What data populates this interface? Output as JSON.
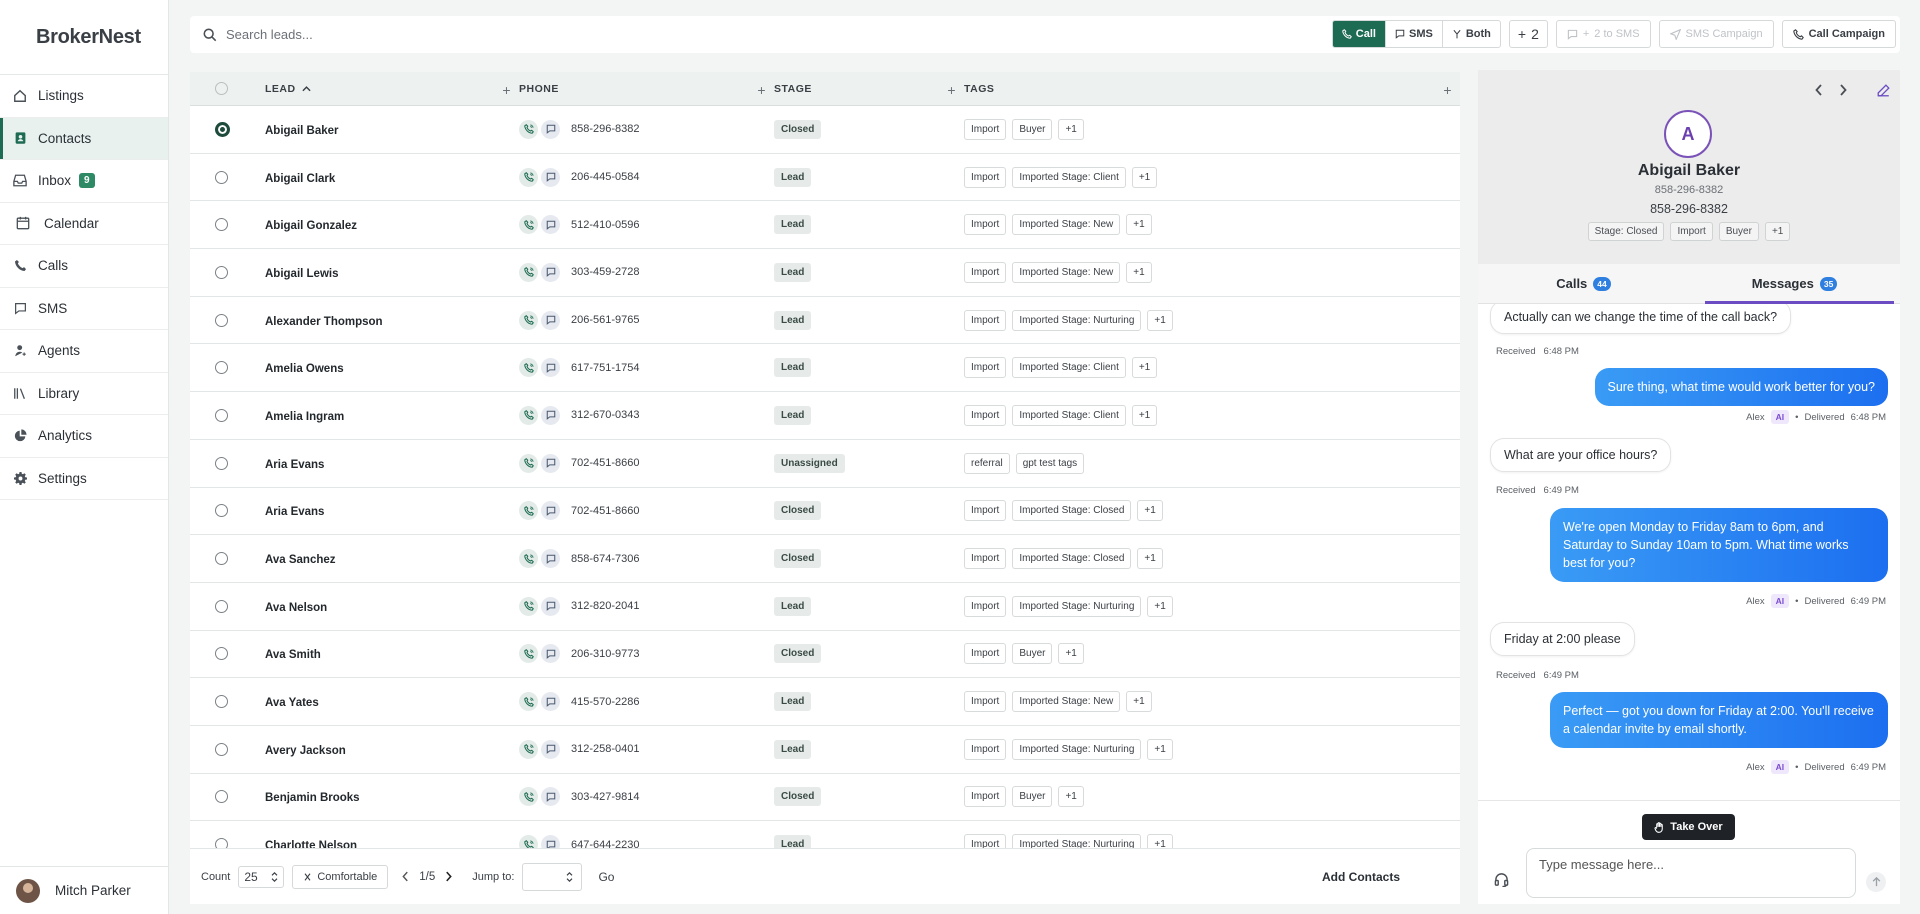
{
  "app": {
    "brand": "BrokerNest"
  },
  "sidebar": {
    "items": [
      {
        "label": "Listings",
        "icon": "home-icon"
      },
      {
        "label": "Contacts",
        "icon": "contact-card-icon",
        "active": true
      },
      {
        "label": "Inbox",
        "icon": "inbox-icon",
        "badge": "9"
      },
      {
        "label": "Calendar",
        "icon": "calendar-icon"
      },
      {
        "label": "Calls",
        "icon": "phone-icon"
      },
      {
        "label": "SMS",
        "icon": "message-icon"
      },
      {
        "label": "Agents",
        "icon": "agent-icon"
      },
      {
        "label": "Library",
        "icon": "library-icon"
      },
      {
        "label": "Analytics",
        "icon": "pie-chart-icon"
      },
      {
        "label": "Settings",
        "icon": "gear-icon"
      }
    ],
    "user": {
      "name": "Mitch Parker"
    }
  },
  "toolbar": {
    "search_placeholder": "Search leads...",
    "mode": {
      "call": "Call",
      "sms": "SMS",
      "both": "Both"
    },
    "add_count": "2",
    "to_sms": "2 to SMS",
    "sms_campaign": "SMS Campaign",
    "call_campaign": "Call Campaign"
  },
  "table": {
    "columns": {
      "lead": "Lead",
      "phone": "Phone",
      "stage": "Stage",
      "tags": "Tags"
    },
    "rows": [
      {
        "name": "Abigail Baker",
        "phone": "858-296-8382",
        "stage": "Closed",
        "tags": [
          "Import",
          "Buyer",
          "+1"
        ],
        "selected": true
      },
      {
        "name": "Abigail Clark",
        "phone": "206-445-0584",
        "stage": "Lead",
        "tags": [
          "Import",
          "Imported Stage: Client",
          "+1"
        ]
      },
      {
        "name": "Abigail Gonzalez",
        "phone": "512-410-0596",
        "stage": "Lead",
        "tags": [
          "Import",
          "Imported Stage: New",
          "+1"
        ]
      },
      {
        "name": "Abigail Lewis",
        "phone": "303-459-2728",
        "stage": "Lead",
        "tags": [
          "Import",
          "Imported Stage: New",
          "+1"
        ]
      },
      {
        "name": "Alexander Thompson",
        "phone": "206-561-9765",
        "stage": "Lead",
        "tags": [
          "Import",
          "Imported Stage: Nurturing",
          "+1"
        ]
      },
      {
        "name": "Amelia Owens",
        "phone": "617-751-1754",
        "stage": "Lead",
        "tags": [
          "Import",
          "Imported Stage: Client",
          "+1"
        ]
      },
      {
        "name": "Amelia Ingram",
        "phone": "312-670-0343",
        "stage": "Lead",
        "tags": [
          "Import",
          "Imported Stage: Client",
          "+1"
        ]
      },
      {
        "name": "Aria Evans",
        "phone": "702-451-8660",
        "stage": "Unassigned",
        "tags": [
          "referral",
          "gpt test tags"
        ]
      },
      {
        "name": "Aria Evans",
        "phone": "702-451-8660",
        "stage": "Closed",
        "tags": [
          "Import",
          "Imported Stage: Closed",
          "+1"
        ]
      },
      {
        "name": "Ava Sanchez",
        "phone": "858-674-7306",
        "stage": "Closed",
        "tags": [
          "Import",
          "Imported Stage: Closed",
          "+1"
        ]
      },
      {
        "name": "Ava Nelson",
        "phone": "312-820-2041",
        "stage": "Lead",
        "tags": [
          "Import",
          "Imported Stage: Nurturing",
          "+1"
        ]
      },
      {
        "name": "Ava Smith",
        "phone": "206-310-9773",
        "stage": "Closed",
        "tags": [
          "Import",
          "Buyer",
          "+1"
        ]
      },
      {
        "name": "Ava Yates",
        "phone": "415-570-2286",
        "stage": "Lead",
        "tags": [
          "Import",
          "Imported Stage: New",
          "+1"
        ]
      },
      {
        "name": "Avery Jackson",
        "phone": "312-258-0401",
        "stage": "Lead",
        "tags": [
          "Import",
          "Imported Stage: Nurturing",
          "+1"
        ]
      },
      {
        "name": "Benjamin Brooks",
        "phone": "303-427-9814",
        "stage": "Closed",
        "tags": [
          "Import",
          "Buyer",
          "+1"
        ]
      },
      {
        "name": "Charlotte Nelson",
        "phone": "647-644-2230",
        "stage": "Lead",
        "tags": [
          "Import",
          "Imported Stage: Nurturing",
          "+1"
        ]
      }
    ]
  },
  "footer": {
    "count_label": "Count",
    "count_value": "25",
    "density": "Comfortable",
    "page": "1/5",
    "jump_label": "Jump to:",
    "go": "Go",
    "add_contacts": "Add Contacts"
  },
  "detail": {
    "initial": "A",
    "name": "Abigail Baker",
    "phone_small": "858-296-8382",
    "phone": "858-296-8382",
    "tags": [
      "Stage: Closed",
      "Import",
      "Buyer",
      "+1"
    ],
    "tabs": [
      {
        "label": "Calls",
        "count": "44"
      },
      {
        "label": "Messages",
        "count": "35",
        "active": true
      }
    ],
    "messages": [
      {
        "dir": "in",
        "text": "Actually can we change the time of the call back?",
        "status": "Received",
        "time": "6:48 PM"
      },
      {
        "dir": "out",
        "text": "Sure thing, what time would work better for you?",
        "sender": "Alex",
        "ai": "AI",
        "status": "Delivered",
        "time": "6:48 PM"
      },
      {
        "dir": "in",
        "text": "What are your office hours?",
        "status": "Received",
        "time": "6:49 PM"
      },
      {
        "dir": "out",
        "text": "We're open Monday to Friday 8am to 6pm, and Saturday to Sunday 10am to 5pm. What time works best for you?",
        "sender": "Alex",
        "ai": "AI",
        "status": "Delivered",
        "time": "6:49 PM"
      },
      {
        "dir": "in",
        "text": "Friday at 2:00 please",
        "status": "Received",
        "time": "6:49 PM"
      },
      {
        "dir": "out",
        "text": "Perfect — got you down for Friday at 2:00. You'll receive a calendar invite by email shortly.",
        "sender": "Alex",
        "ai": "AI",
        "status": "Delivered",
        "time": "6:49 PM"
      }
    ],
    "take_over": "Take Over",
    "composer_placeholder": "Type message here..."
  }
}
